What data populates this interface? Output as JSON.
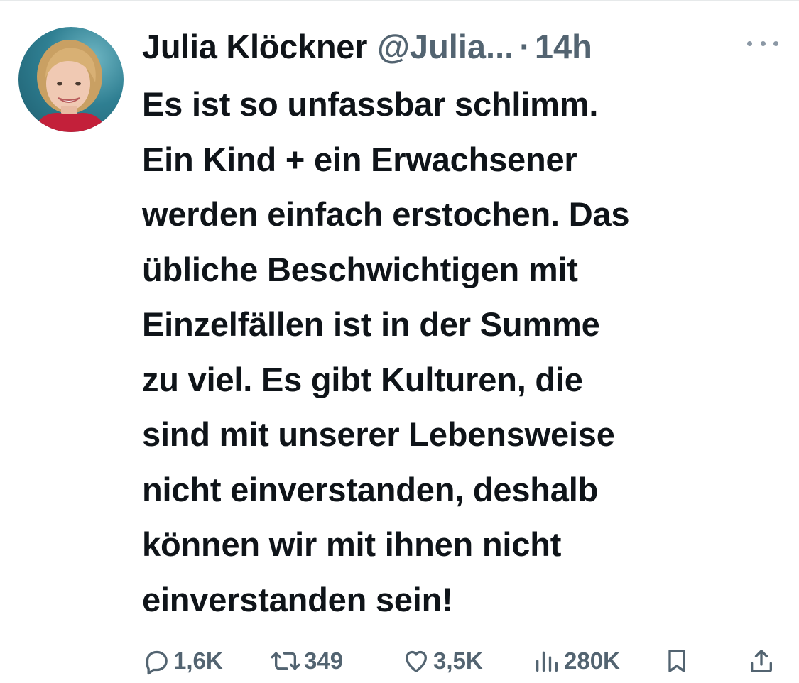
{
  "tweet": {
    "author": {
      "display_name": "Julia Klöckner",
      "handle": "@Julia...",
      "avatar_icon": "profile-photo"
    },
    "separator": "·",
    "time": "14h",
    "menu_icon": "more-horizontal-icon",
    "text_lines": [
      "Es ist so unfassbar schlimm.",
      "Ein Kind + ein Erwachsener",
      "werden einfach erstochen. Das",
      "übliche Beschwichtigen mit",
      "Einzelfällen ist in der Summe",
      "zu viel. Es gibt Kulturen, die",
      "sind mit unserer Lebensweise",
      "nicht einverstanden, deshalb",
      "können wir mit ihnen nicht",
      "einverstanden sein!"
    ],
    "actions": {
      "replies": {
        "icon": "reply-icon",
        "count": "1,6K"
      },
      "retweets": {
        "icon": "retweet-icon",
        "count": "349"
      },
      "likes": {
        "icon": "heart-icon",
        "count": "3,5K"
      },
      "views": {
        "icon": "views-icon",
        "count": "280K"
      },
      "bookmark": {
        "icon": "bookmark-icon"
      },
      "share": {
        "icon": "share-icon"
      }
    }
  },
  "colors": {
    "text_primary": "#0f1419",
    "text_secondary": "#536471",
    "divider": "#e6e9ea",
    "avatar_background": "#2f7f92"
  }
}
